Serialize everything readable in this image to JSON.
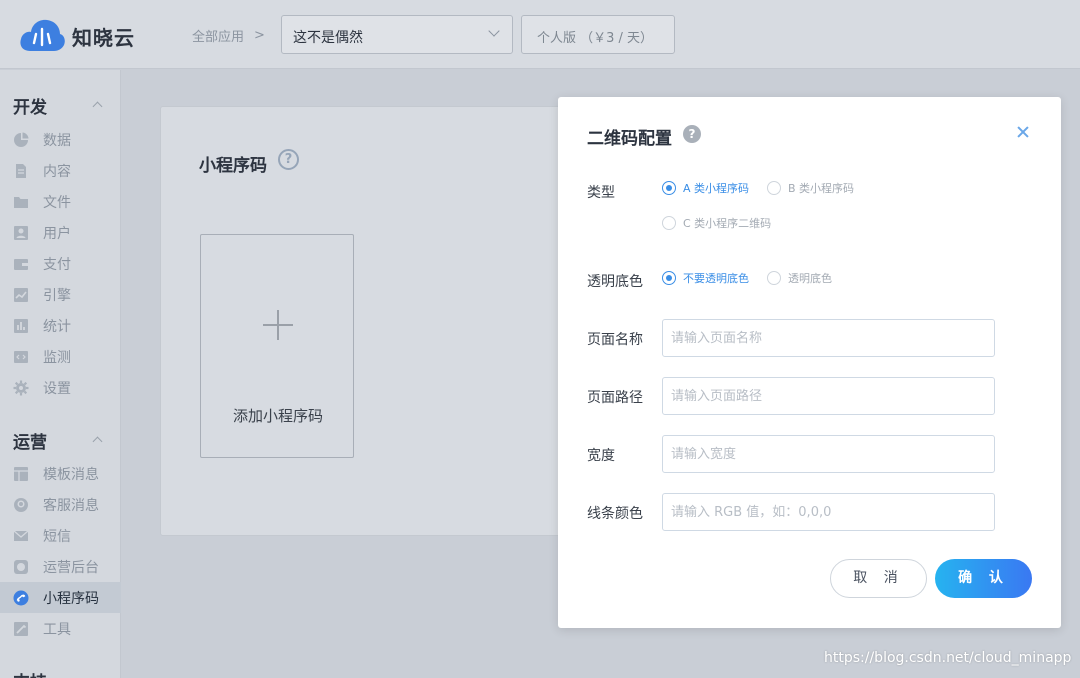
{
  "app": {
    "name": "知晓云"
  },
  "topbar": {
    "breadcrumb": "全部应用",
    "app_select": "这不是偶然",
    "plan": "个人版 （￥3 / 天）"
  },
  "sidebar": {
    "groups": [
      {
        "title": "开发",
        "items": [
          {
            "label": "数据",
            "icon": "pie-chart-icon"
          },
          {
            "label": "内容",
            "icon": "document-icon"
          },
          {
            "label": "文件",
            "icon": "folder-icon"
          },
          {
            "label": "用户",
            "icon": "user-card-icon"
          },
          {
            "label": "支付",
            "icon": "wallet-icon"
          },
          {
            "label": "引擎",
            "icon": "trend-icon"
          },
          {
            "label": "统计",
            "icon": "bar-chart-icon"
          },
          {
            "label": "监测",
            "icon": "code-icon"
          },
          {
            "label": "设置",
            "icon": "gear-icon"
          }
        ]
      },
      {
        "title": "运营",
        "items": [
          {
            "label": "模板消息",
            "icon": "template-icon"
          },
          {
            "label": "客服消息",
            "icon": "headset-icon"
          },
          {
            "label": "短信",
            "icon": "mail-icon"
          },
          {
            "label": "运营后台",
            "icon": "dashboard-icon"
          },
          {
            "label": "小程序码",
            "icon": "miniprogram-icon",
            "active": true
          },
          {
            "label": "工具",
            "icon": "wrench-icon"
          }
        ]
      },
      {
        "title": "支持",
        "items": []
      }
    ]
  },
  "main": {
    "title": "小程序码",
    "add_label": "添加小程序码"
  },
  "modal": {
    "title": "二维码配置",
    "fields": {
      "type": {
        "label": "类型",
        "options": [
          {
            "label": "A 类小程序码",
            "checked": true
          },
          {
            "label": "B 类小程序码",
            "checked": false
          },
          {
            "label": "C 类小程序二维码",
            "checked": false
          }
        ]
      },
      "transparent": {
        "label": "透明底色",
        "options": [
          {
            "label": "不要透明底色",
            "checked": true
          },
          {
            "label": "透明底色",
            "checked": false
          }
        ]
      },
      "page_name": {
        "label": "页面名称",
        "placeholder": "请输入页面名称",
        "value": ""
      },
      "page_path": {
        "label": "页面路径",
        "placeholder": "请输入页面路径",
        "value": ""
      },
      "width": {
        "label": "宽度",
        "placeholder": "请输入宽度",
        "value": ""
      },
      "line_color": {
        "label": "线条颜色",
        "placeholder": "请输入 RGB 值，如：0,0,0",
        "value": ""
      }
    },
    "cancel_label": "取 消",
    "confirm_label": "确 认"
  },
  "watermark": "https://blog.csdn.net/cloud_minapp",
  "colors": {
    "accent": "#3a8ee6",
    "overlay": "#c9ced6",
    "confirm_gradient_start": "#26b3f0",
    "confirm_gradient_end": "#3a78f2"
  }
}
